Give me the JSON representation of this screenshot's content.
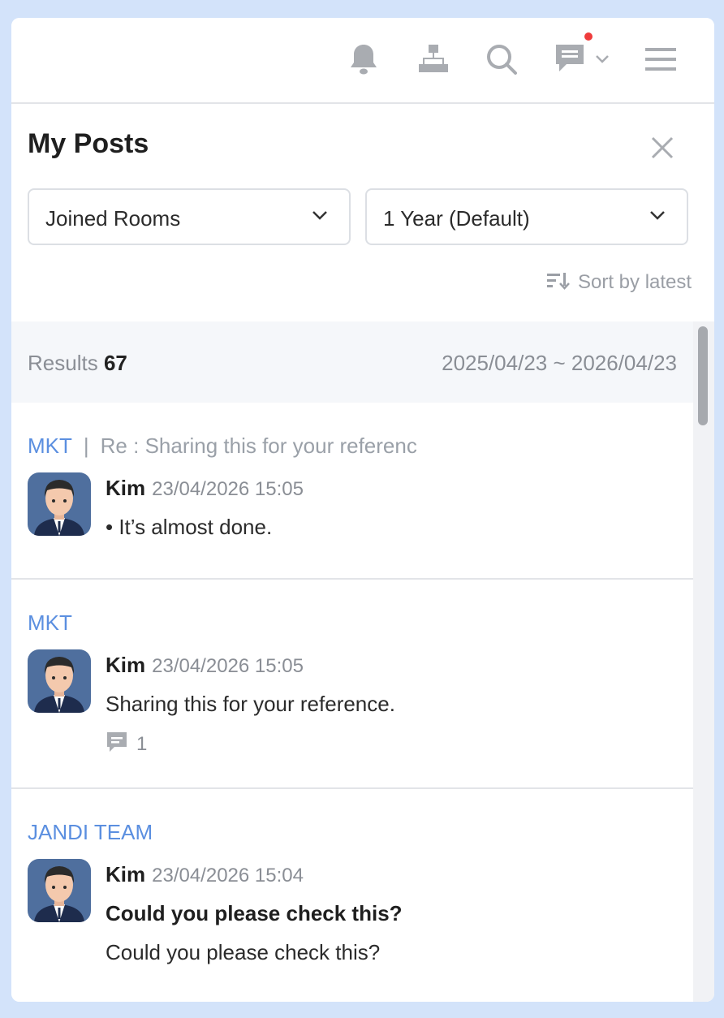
{
  "topbar": {
    "icons": [
      "bell-icon",
      "org-chart-icon",
      "search-icon",
      "chat-icon",
      "chevron-down-icon",
      "menu-icon"
    ]
  },
  "panel": {
    "title": "My Posts",
    "room_filter": "Joined Rooms",
    "period_filter": "1 Year (Default)",
    "sort_label": "Sort by latest",
    "results_label": "Results",
    "results_count": "67",
    "date_range": "2025/04/23 ~ 2026/04/23"
  },
  "posts": [
    {
      "room": "MKT",
      "separator": "|",
      "subject": "Re : Sharing this for your referenc",
      "author": "Kim",
      "time": "23/04/2026 15:05",
      "message": "• It’s almost done."
    },
    {
      "room": "MKT",
      "author": "Kim",
      "time": "23/04/2026 15:05",
      "message": "Sharing this for your reference.",
      "comment_count": "1"
    },
    {
      "room": "JANDI TEAM",
      "author": "Kim",
      "time": "23/04/2026 15:04",
      "title": "Could you please check this?",
      "message": "Could you please check this?"
    }
  ],
  "colors": {
    "background": "#d3e3fa",
    "room_link": "#5b8fe0",
    "notification_dot": "#ef3b3b",
    "muted_text": "#8a8e95"
  }
}
